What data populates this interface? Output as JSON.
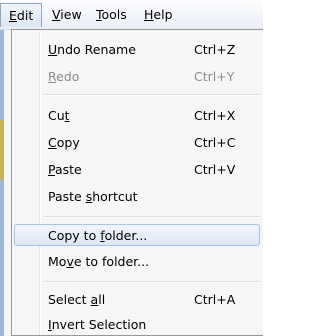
{
  "menubar": {
    "items": [
      {
        "pre": "",
        "ul": "E",
        "post": "dit"
      },
      {
        "pre": "",
        "ul": "V",
        "post": "iew"
      },
      {
        "pre": "",
        "ul": "T",
        "post": "ools"
      },
      {
        "pre": "",
        "ul": "H",
        "post": "elp"
      }
    ]
  },
  "edit_menu": {
    "items": [
      {
        "pre": "",
        "ul": "U",
        "post": "ndo Rename",
        "shortcut": "Ctrl+Z"
      },
      {
        "pre": "",
        "ul": "R",
        "post": "edo",
        "shortcut": "Ctrl+Y"
      },
      {
        "pre": "Cu",
        "ul": "t",
        "post": "",
        "shortcut": "Ctrl+X"
      },
      {
        "pre": "",
        "ul": "C",
        "post": "opy",
        "shortcut": "Ctrl+C"
      },
      {
        "pre": "",
        "ul": "P",
        "post": "aste",
        "shortcut": "Ctrl+V"
      },
      {
        "pre": "Paste ",
        "ul": "s",
        "post": "hortcut",
        "shortcut": ""
      },
      {
        "pre": "Copy to ",
        "ul": "f",
        "post": "older...",
        "shortcut": ""
      },
      {
        "pre": "Mo",
        "ul": "v",
        "post": "e to folder...",
        "shortcut": ""
      },
      {
        "pre": "Select ",
        "ul": "a",
        "post": "ll",
        "shortcut": "Ctrl+A"
      },
      {
        "pre": "",
        "ul": "I",
        "post": "nvert Selection",
        "shortcut": ""
      }
    ]
  }
}
